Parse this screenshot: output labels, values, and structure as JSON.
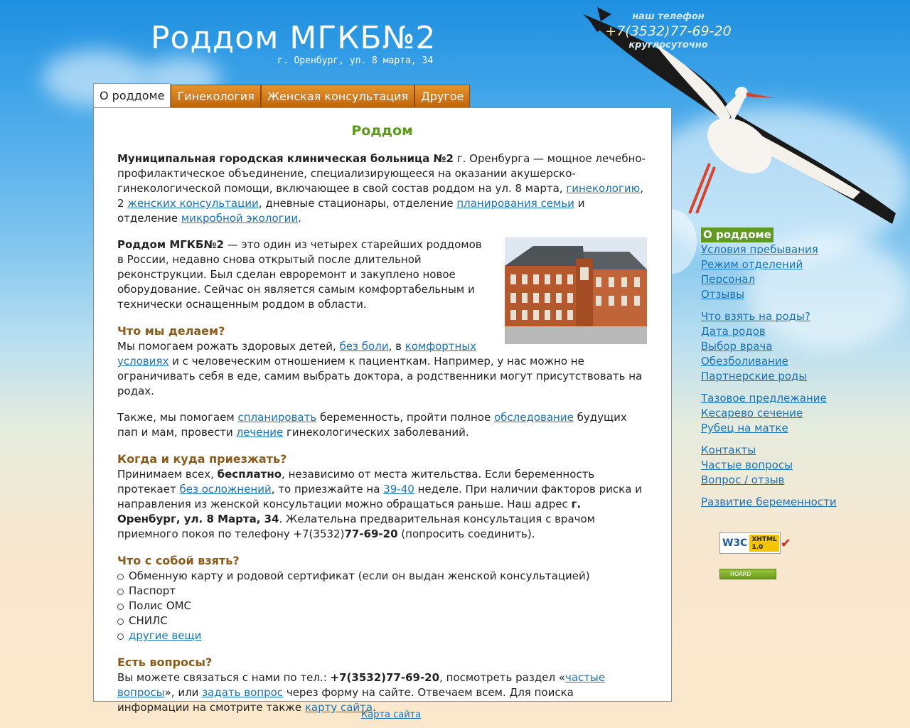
{
  "header": {
    "title": "Роддом МГКБ№2",
    "address": "г. Оренбург, ул. 8 марта, 34",
    "phone_label": "наш телефон",
    "phone": "+7(3532)77-69-20",
    "phone_hours": "круглосуточно"
  },
  "tabs": [
    "О роддоме",
    "Гинекология",
    "Женская консультация",
    "Другое"
  ],
  "main": {
    "heading": "Роддом",
    "p1": {
      "bold": "Муниципальная городская клиническая больница №2",
      "t1": " г. Оренбурга — мощное лечебно-профилактическое объединение, специализирующееся на оказании акушерско-гинекологической помощи, включающее в свой состав роддом на ул. 8 марта, ",
      "link1": "гинекологию",
      "t2": ", 2 ",
      "link2": "женских консультации",
      "t3": ", дневные стационары, отделение ",
      "link3": "планирования семьи",
      "t4": " и отделение ",
      "link4": "микробной экологии",
      "t5": "."
    },
    "p2": {
      "bold": "Роддом МГКБ№2",
      "text": " — это один из четырех старейших роддомов в России, недавно снова открытый после длительной реконструкции. Был сделан евроремонт и закуплено новое оборудование. Сейчас он является самым комфортабельным и технически оснащенным роддом в области."
    },
    "section_what": {
      "heading": "Что мы делаем?",
      "t1": "Мы помогаем рожать здоровых детей, ",
      "link1": "без боли",
      "t2": ", в ",
      "link2": "комфортных условиях",
      "t3": " и с человеческим отношением к пациенткам. Например, у нас можно не ограничивать себя в еде, самим выбрать доктора, а родственники могут присутствовать на родах."
    },
    "p3": {
      "t1": "Также, мы помогаем ",
      "link1": "спланировать",
      "t2": " беременность, пройти полное ",
      "link2": "обследование",
      "t3": " будущих пап и мам, провести ",
      "link3": "лечение",
      "t4": " гинекологических заболеваний."
    },
    "section_when": {
      "heading": "Когда и куда приезжать?",
      "t1": "Принимаем всех, ",
      "bold1": "бесплатно",
      "t2": ", независимо от места жительства. Если беременность протекает ",
      "link1": "без осложнений",
      "t3": ", то приезжайте на ",
      "link2": "39-40",
      "t4": " неделе. При наличии факторов риска и направления из женской консультации можно обращаться раньше. Наш адрес ",
      "bold2": "г. Оренбург, ул. 8 Марта, 34",
      "t5": ". Желательна предварительная консультация с врачом приемного покоя по телефону +7(3532)",
      "bold3": "77-69-20",
      "t6": " (попросить соединить)."
    },
    "section_bring": {
      "heading": "Что с собой взять?",
      "items": [
        "Обменную карту и родовой сертификат (если он выдан женской консультацией)",
        "Паспорт",
        "Полис ОМС",
        "СНИЛС"
      ],
      "link_item": "другие вещи"
    },
    "section_questions": {
      "heading": "Есть вопросы?",
      "t1": "Вы можете связаться с нами по тел.: ",
      "bold1": "+7(3532)77-69-20",
      "t2": ", посмотреть раздел «",
      "link1": "частые вопросы",
      "t3": "», или ",
      "link2": "задать вопрос",
      "t4": " через форму на сайте. Отвечаем всем. Для поиска информации на смотрите также ",
      "link3": "карту сайта",
      "t5": "."
    }
  },
  "sidebar": {
    "current": "О роддоме",
    "group1": [
      "Условия пребывания",
      "Режим отделений",
      "Персонал",
      "Отзывы"
    ],
    "group2": [
      "Что взять на роды?",
      "Дата родов",
      "Выбор врача",
      "Обезболивание",
      "Партнерские роды"
    ],
    "group3": [
      "Тазовое предлежание",
      "Кесарево сечение",
      "Рубец на матке"
    ],
    "group4": [
      "Контакты",
      "Частые вопросы",
      "Вопрос / отзыв"
    ],
    "group5": [
      "Развитие беременности"
    ]
  },
  "badges": {
    "w3c": "W3C",
    "xhtml": "XHTML",
    "xhtml_version": "1.0",
    "hoard": "HOARD"
  },
  "footer": {
    "sitemap": "Карта сайта"
  },
  "colors": {
    "tab_orange": "#d07a1c",
    "heading_green": "#5b9a1c",
    "section_brown": "#8a5b1a",
    "link_blue": "#1a72b8",
    "sidebar_current_bg": "#5e9a20"
  }
}
